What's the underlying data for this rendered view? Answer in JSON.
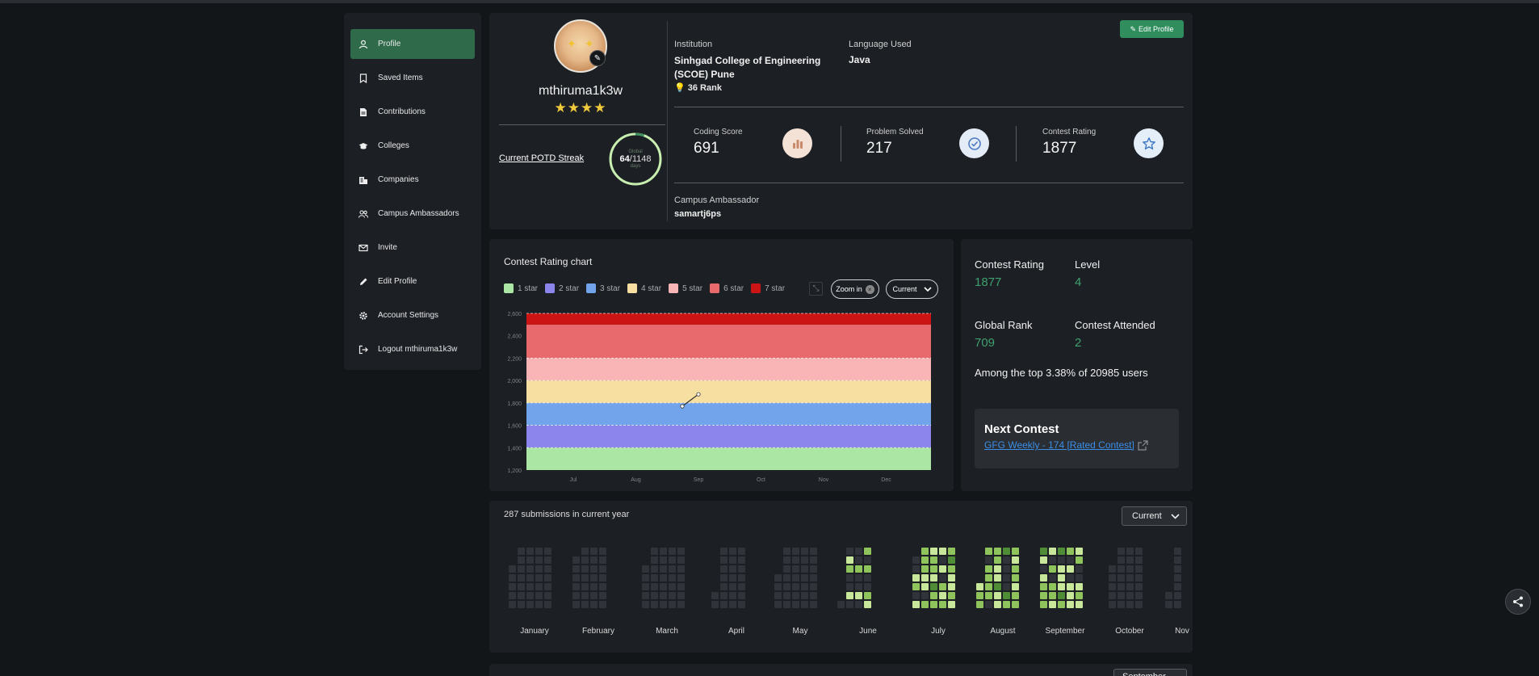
{
  "sidebar": {
    "items": [
      {
        "label": "Profile",
        "icon": "user-icon",
        "active": true
      },
      {
        "label": "Saved Items",
        "icon": "bookmark-icon"
      },
      {
        "label": "Contributions",
        "icon": "document-icon"
      },
      {
        "label": "Colleges",
        "icon": "graduation-cap-icon"
      },
      {
        "label": "Companies",
        "icon": "building-icon"
      },
      {
        "label": "Campus Ambassadors",
        "icon": "users-icon"
      },
      {
        "label": "Invite",
        "icon": "mail-icon"
      },
      {
        "label": "Edit Profile",
        "icon": "pencil-icon"
      },
      {
        "label": "Account Settings",
        "icon": "gear-icon"
      },
      {
        "label": "Logout mthiruma1k3w",
        "icon": "logout-icon"
      }
    ]
  },
  "profile": {
    "username": "mthiruma1k3w",
    "stars": "★★★★",
    "potd_link": "Current POTD Streak",
    "streak": {
      "label": "Global",
      "current": "64",
      "total": "/1148",
      "unit": "days",
      "fraction": 0.0557
    },
    "edit_button": "Edit Profile",
    "institution_label": "Institution",
    "institution": "Sinhgad College of Engineering (SCOE) Pune",
    "rank": "36 Rank",
    "language_label": "Language Used",
    "language": "Java",
    "stats": [
      {
        "label": "Coding Score",
        "value": "691",
        "icon": "bar-chart-icon",
        "icon_bg": "#f5e2d6",
        "icon_color": "#c88a6a"
      },
      {
        "label": "Problem Solved",
        "value": "217",
        "icon": "check-circle-icon",
        "icon_bg": "#e4ecf7",
        "icon_color": "#4d7cc2"
      },
      {
        "label": "Contest Rating",
        "value": "1877",
        "icon": "star-icon",
        "icon_bg": "#e4eef9",
        "icon_color": "#3b78c4"
      }
    ],
    "ambassador_label": "Campus Ambassador",
    "ambassador": "samartj6ps"
  },
  "contest_chart": {
    "title": "Contest Rating chart",
    "legend": [
      {
        "label": "1 star",
        "color": "#abe6a4"
      },
      {
        "label": "2 star",
        "color": "#8c85ec"
      },
      {
        "label": "3 star",
        "color": "#72a4ec"
      },
      {
        "label": "4 star",
        "color": "#f7dfa1"
      },
      {
        "label": "5 star",
        "color": "#f9b4b5"
      },
      {
        "label": "6 star",
        "color": "#e86a6c"
      },
      {
        "label": "7 star",
        "color": "#cc1414"
      }
    ],
    "zoom_label": "Zoom in",
    "range_label": "Current"
  },
  "chart_data": {
    "type": "line",
    "title": "Contest Rating chart",
    "ylim": [
      1200,
      2600
    ],
    "yticks": [
      "1,200",
      "1,400",
      "1,600",
      "1,800",
      "2,000",
      "2,200",
      "2,400",
      "2,600"
    ],
    "xticks": [
      "Jul",
      "Aug",
      "Sep",
      "Oct",
      "Nov",
      "Dec"
    ],
    "bands": [
      {
        "name": "1 star",
        "from": 1200,
        "to": 1400,
        "color": "#abe6a4"
      },
      {
        "name": "2 star",
        "from": 1400,
        "to": 1600,
        "color": "#8c85ec"
      },
      {
        "name": "3 star",
        "from": 1600,
        "to": 1800,
        "color": "#72a4ec"
      },
      {
        "name": "4 star",
        "from": 1800,
        "to": 2000,
        "color": "#f7dfa1"
      },
      {
        "name": "5 star",
        "from": 2000,
        "to": 2200,
        "color": "#f9b4b5"
      },
      {
        "name": "6 star",
        "from": 2200,
        "to": 2500,
        "color": "#e86a6c"
      },
      {
        "name": "7 star",
        "from": 2500,
        "to": 2600,
        "color": "#cc1414"
      }
    ],
    "series": [
      {
        "x": [
          "Aug 24",
          "Sep 1"
        ],
        "values": [
          1770,
          1877
        ]
      }
    ],
    "grid": true
  },
  "contest_stats": {
    "rating_label": "Contest Rating",
    "rating": "1877",
    "level_label": "Level",
    "level": "4",
    "global_rank_label": "Global Rank",
    "global_rank": "709",
    "attended_label": "Contest Attended",
    "attended": "2",
    "top_text": "Among the top 3.38% of 20985 users",
    "next_title": "Next Contest",
    "next_link": "GFG Weekly - 174 [Rated Contest]"
  },
  "submissions": {
    "count_text": "287 submissions in current year",
    "year_select": "Current",
    "months": [
      "January",
      "February",
      "March",
      "April",
      "May",
      "June",
      "July",
      "August",
      "September",
      "October",
      "Nov"
    ],
    "colors": {
      "empty": "#30343a",
      "l1": "#c9e79a",
      "l2": "#8fc35b",
      "l3": "#4f8c36"
    }
  },
  "bottom_select": "September"
}
